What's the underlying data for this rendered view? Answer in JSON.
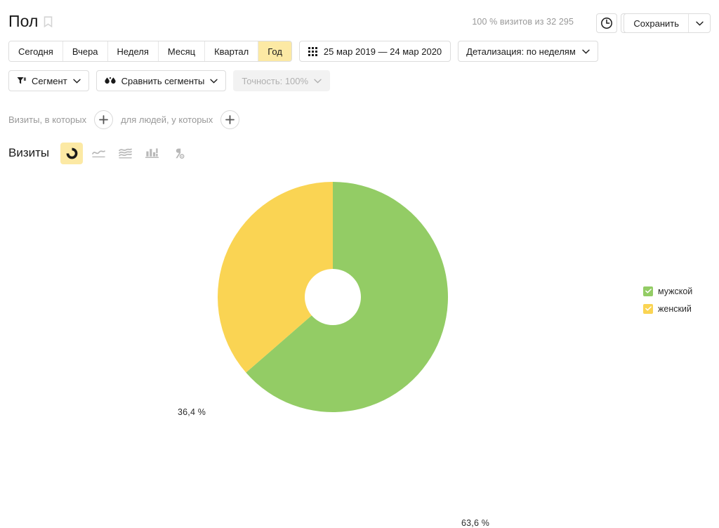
{
  "header": {
    "title": "Пол",
    "bookmark_icon": "bookmark-outline-icon",
    "visits_note": "100 % визитов из 32 295",
    "history_icon": "clock-icon",
    "export_icon": "export-upload-icon",
    "save_label": "Сохранить",
    "save_arrow_icon": "chevron-down-icon"
  },
  "period": {
    "buttons": [
      {
        "label": "Сегодня",
        "active": false
      },
      {
        "label": "Вчера",
        "active": false
      },
      {
        "label": "Неделя",
        "active": false
      },
      {
        "label": "Месяц",
        "active": false
      },
      {
        "label": "Квартал",
        "active": false
      },
      {
        "label": "Год",
        "active": true
      }
    ],
    "date_range": "25 мар 2019 — 24 мар 2020",
    "calendar_icon": "calendar-icon",
    "detail_label": "Детализация: по неделям",
    "detail_arrow_icon": "chevron-down-icon"
  },
  "segments": {
    "segment_label": "Сегмент",
    "segment_icon": "funnel-icon",
    "compare_label": "Сравнить сегменты",
    "compare_icon": "compare-drops-icon",
    "accuracy_label": "Точность: 100%",
    "accuracy_disabled": true,
    "arrow_icon": "chevron-down-icon"
  },
  "filters": {
    "visits_label": "Визиты, в которых",
    "people_label": "для людей, у которых",
    "add_icon": "plus-icon"
  },
  "metric": {
    "name": "Визиты",
    "chart_types": [
      {
        "name": "pie-chart-icon",
        "active": true
      },
      {
        "name": "line-chart-icon",
        "active": false
      },
      {
        "name": "area-chart-icon",
        "active": false
      },
      {
        "name": "bar-chart-icon",
        "active": false
      },
      {
        "name": "map-pin-icon",
        "active": false
      }
    ]
  },
  "legend": {
    "items": [
      {
        "label": "мужской",
        "color": "#93cc65",
        "checked": true
      },
      {
        "label": "женский",
        "color": "#fad453",
        "checked": true
      }
    ]
  },
  "colors": {
    "male": "#93cc65",
    "female": "#fad453",
    "active_tab": "#fce9a4",
    "border": "#dcdcdc",
    "muted_text": "#999999"
  },
  "chart_data": {
    "type": "pie",
    "title": "Визиты",
    "subtitle": "Пол",
    "variant": "donut",
    "categories": [
      "мужской",
      "женский"
    ],
    "values": [
      63.6,
      36.4
    ],
    "value_unit": "%",
    "data_labels": [
      "63,6 %",
      "36,4 %"
    ],
    "colors": [
      "#93cc65",
      "#fad453"
    ],
    "total_visits": 32295,
    "total_label": "100 % визитов из 32 295",
    "legend_position": "right",
    "grid": false,
    "start_angle_deg": 0,
    "direction": "clockwise",
    "inner_radius_ratio": 0.245
  }
}
